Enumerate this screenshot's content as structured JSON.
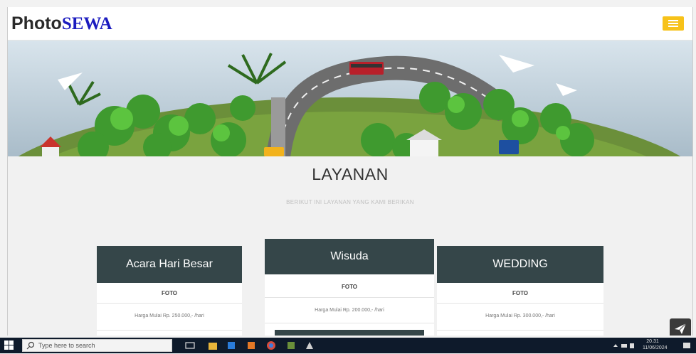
{
  "brand": {
    "part1": "Photo",
    "part2": "SEWA"
  },
  "section": {
    "title": "LAYANAN",
    "subtitle": "BERIKUT INI LAYANAN YANG KAMI BERIKAN"
  },
  "cards": [
    {
      "title": "Acara Hari Besar",
      "label": "FOTO",
      "price": "Harga Mulai Rp. 250.000,- /hari",
      "button": ""
    },
    {
      "title": "Wisuda",
      "label": "FOTO",
      "price": "Harga Mulai Rp. 200.000,- /hari",
      "button": ""
    },
    {
      "title": "WEDDING",
      "label": "FOTO",
      "price": "Harga Mulai Rp. 300.000,- /hari",
      "button": ""
    }
  ],
  "taskbar": {
    "search_placeholder": "Type here to search",
    "time": "20.31",
    "date": "11/06/2024"
  },
  "colors": {
    "brand_dark": "#2a2a2a",
    "brand_blue": "#1b1bbf",
    "menu_button": "#f7c21a",
    "card_header": "#354649",
    "taskbar": "#0e1a2b"
  },
  "icons": {
    "menu": "hamburger-icon",
    "send": "paper-plane-icon",
    "windows": "windows-logo-icon",
    "search": "search-icon"
  }
}
